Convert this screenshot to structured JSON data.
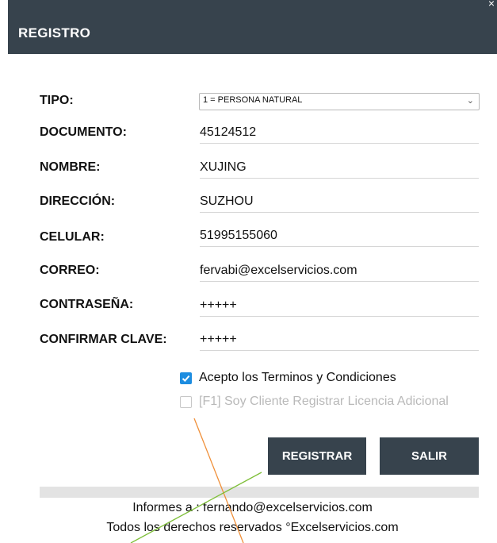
{
  "window": {
    "title": "REGISTRO",
    "close_glyph": "×"
  },
  "form": {
    "tipo": {
      "label": "TIPO:",
      "value": "1 = PERSONA NATURAL"
    },
    "documento": {
      "label": "DOCUMENTO:",
      "value": "45124512"
    },
    "nombre": {
      "label": "NOMBRE:",
      "value": "XUJING"
    },
    "direccion": {
      "label": "DIRECCIÓN:",
      "value": "SUZHOU"
    },
    "celular": {
      "label": "CELULAR:",
      "value": "51995155060"
    },
    "correo": {
      "label": "CORREO:",
      "value": "fervabi@excelservicios.com"
    },
    "contrasena": {
      "label": "CONTRASEÑA:",
      "value": "+++++"
    },
    "confirmar": {
      "label": "CONFIRMAR CLAVE:",
      "value": "+++++"
    }
  },
  "checkboxes": {
    "terms": {
      "label": "Acepto los Terminos y Condiciones",
      "checked": true
    },
    "license": {
      "label": "[F1] Soy Cliente Registrar Licencia Adicional",
      "checked": false
    }
  },
  "buttons": {
    "register": "REGISTRAR",
    "exit": "SALIR"
  },
  "footer": {
    "line1": "Informes a : fernando@excelservicios.com",
    "line2": "Todos los derechos reservados °Excelservicios.com"
  },
  "colors": {
    "titlebar": "#37434d",
    "button": "#37434d",
    "checkbox_accent": "#1d8de0",
    "annotation_orange": "#f0903a",
    "annotation_green": "#7fbf3a"
  }
}
